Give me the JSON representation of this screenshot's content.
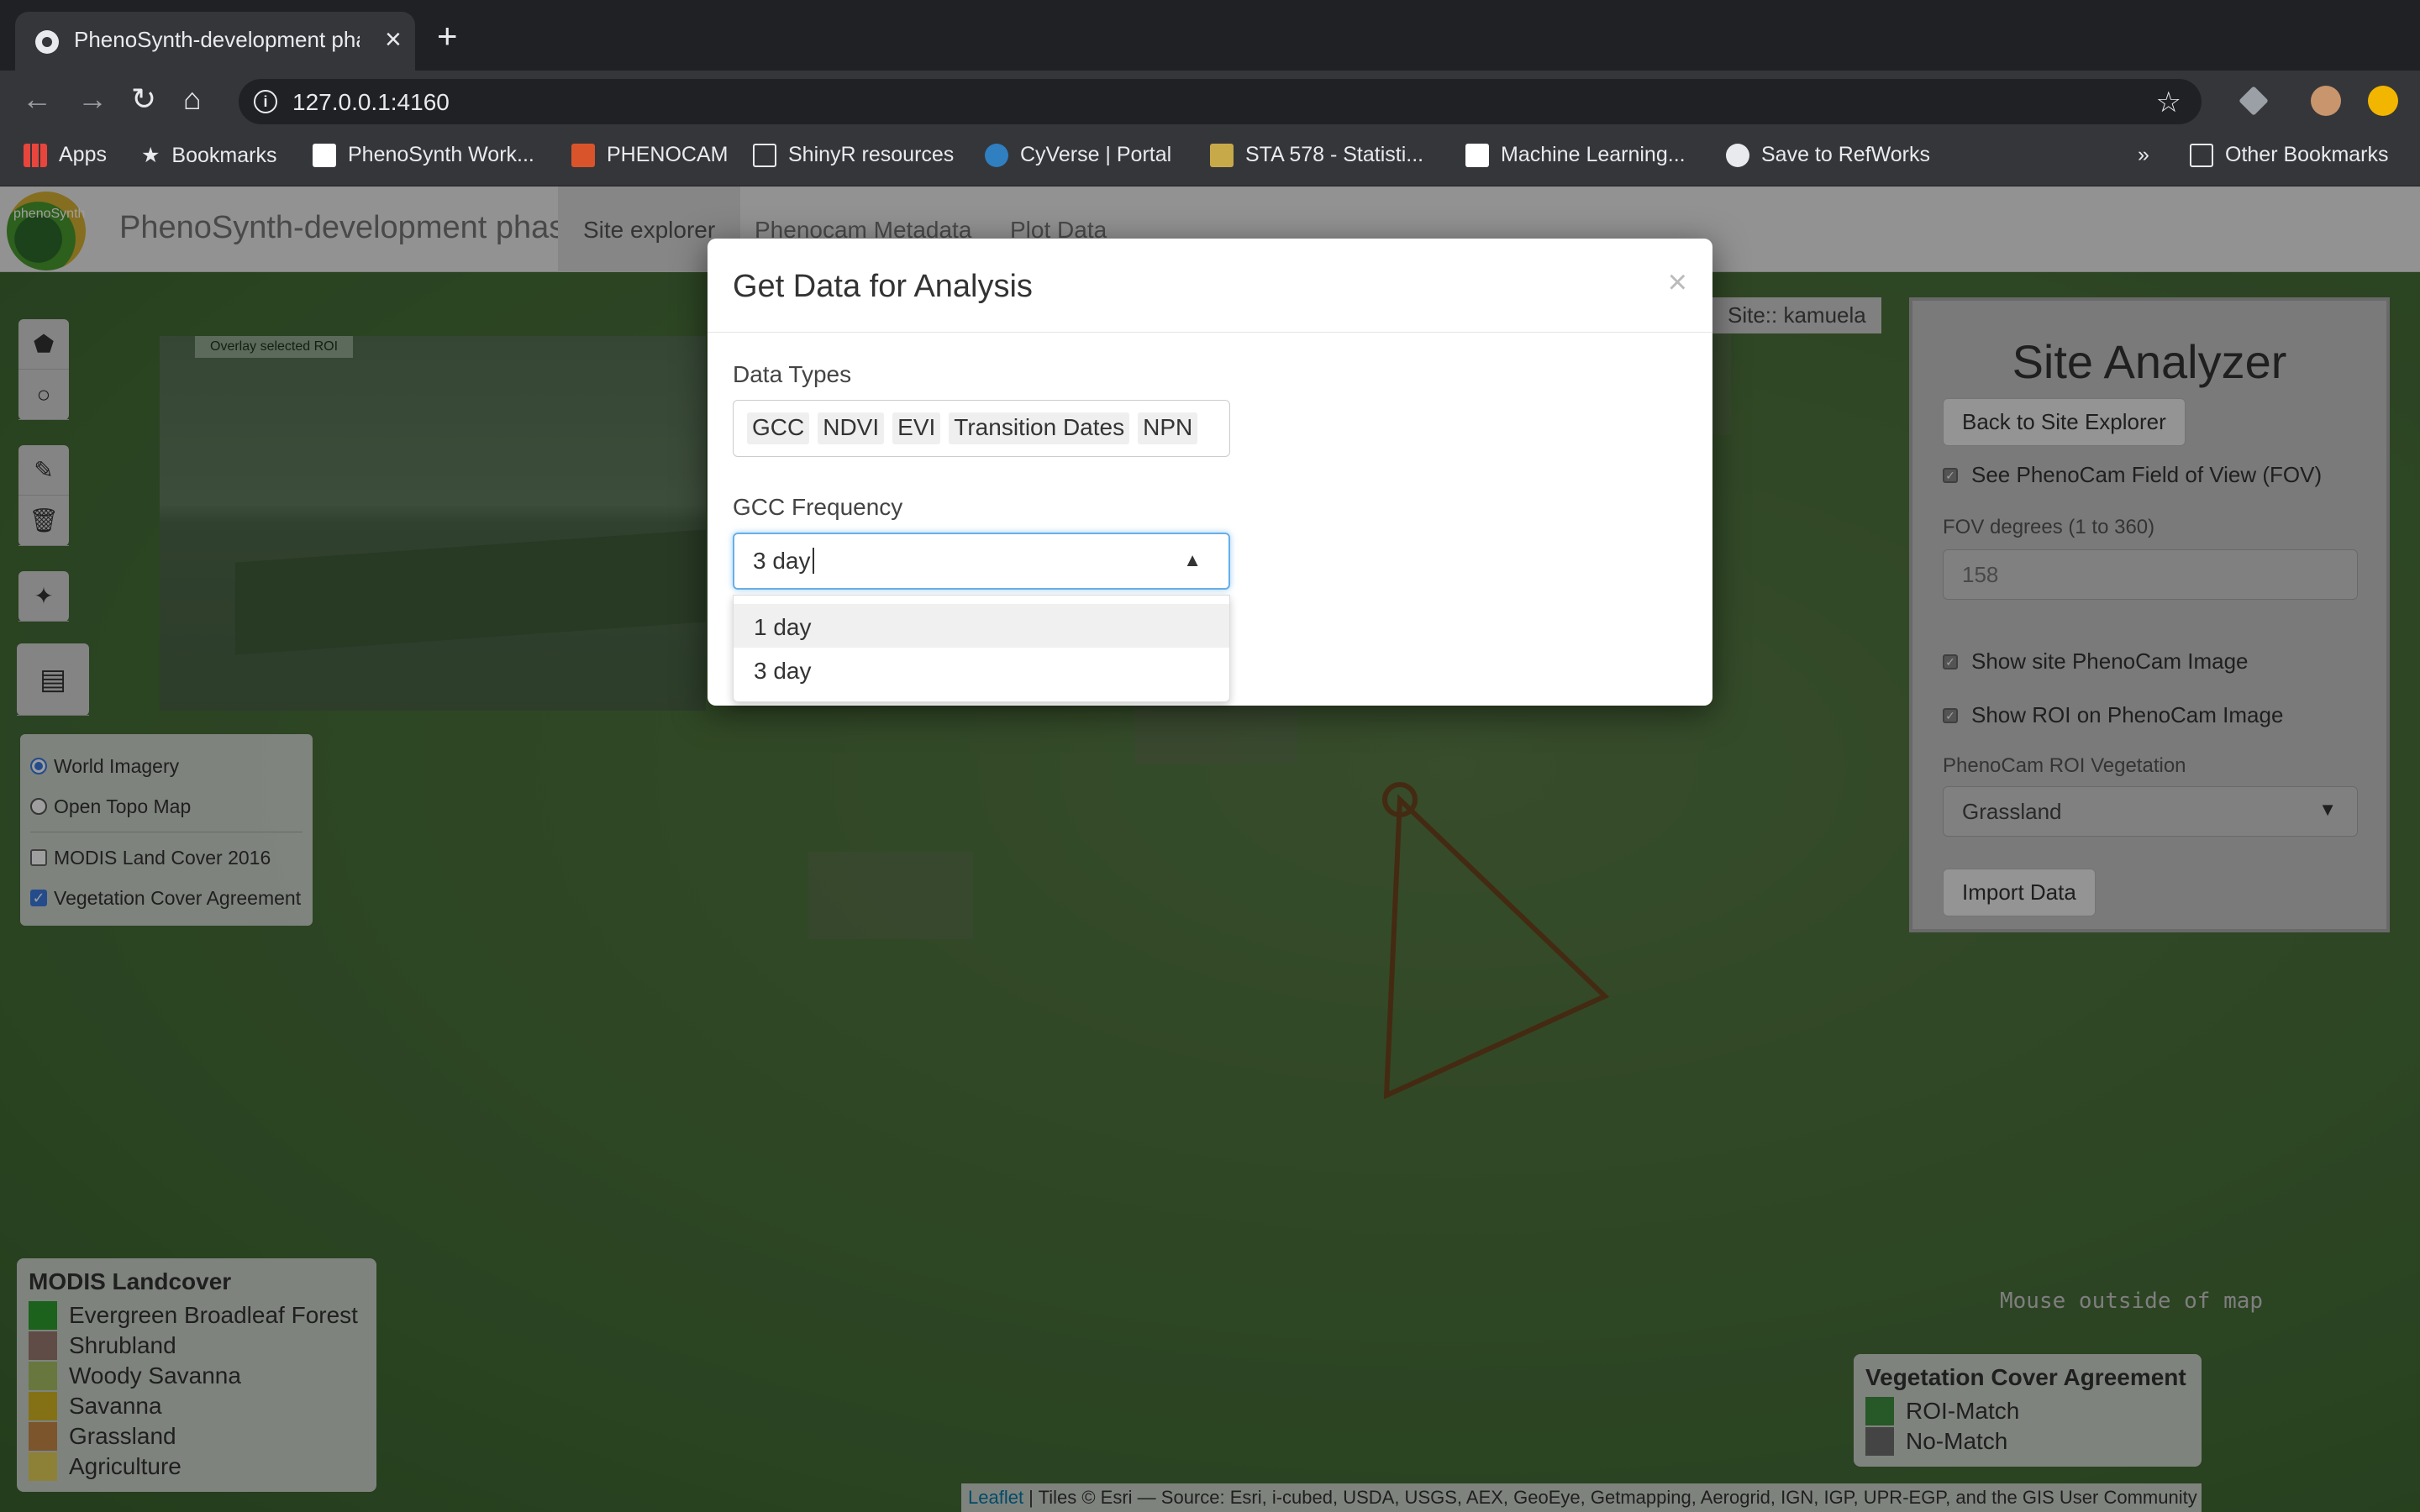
{
  "browser": {
    "tab_title": "PhenoSynth-development pha",
    "url": "127.0.0.1:4160",
    "bookmarks": [
      "Apps",
      "Bookmarks",
      "PhenoSynth Work...",
      "PHENOCAM",
      "ShinyR resources",
      "CyVerse | Portal",
      "STA 578 - Statisti...",
      "Machine Learning...",
      "Save to RefWorks"
    ],
    "more": "»",
    "other_bookmarks": "Other Bookmarks"
  },
  "app": {
    "logo_text": "phenoSynth",
    "brand": "PhenoSynth-development phase",
    "tabs": [
      "Site explorer",
      "Phenocam Metadata",
      "Plot Data"
    ]
  },
  "map": {
    "overlay_roi_label": "Overlay selected ROI",
    "site_badge": "Site:: kamuela",
    "layers": {
      "base": [
        "World Imagery",
        "Open Topo Map"
      ],
      "overlays": [
        "MODIS Land Cover 2016",
        "Vegetation Cover Agreement"
      ]
    },
    "modis_legend": {
      "title": "MODIS Landcover",
      "items": [
        {
          "label": "Evergreen Broadleaf Forest",
          "color": "#2e9e2e"
        },
        {
          "label": "Shrubland",
          "color": "#9b7b72"
        },
        {
          "label": "Woody Savanna",
          "color": "#a8c064"
        },
        {
          "label": "Savanna",
          "color": "#d6b624"
        },
        {
          "label": "Grassland",
          "color": "#c8894a"
        },
        {
          "label": "Agriculture",
          "color": "#e2d05a"
        }
      ]
    },
    "veg_legend": {
      "title": "Vegetation Cover Agreement",
      "items": [
        {
          "label": "ROI-Match",
          "color": "#3f8f3f"
        },
        {
          "label": "No-Match",
          "color": "#6e6e6e"
        }
      ]
    },
    "mouse_readout": "Mouse outside of map",
    "attribution_link": "Leaflet",
    "attribution_text": " | Tiles © Esri — Source: Esri, i-cubed, USDA, USGS, AEX, GeoEye, Getmapping, Aerogrid, IGN, IGP, UPR-EGP, and the GIS User Community"
  },
  "analyzer": {
    "title": "Site Analyzer",
    "back_button": "Back to Site Explorer",
    "fov_check": "See PhenoCam Field of View (FOV)",
    "fov_label": "FOV degrees (1 to 360)",
    "fov_value": "158",
    "show_image": "Show site PhenoCam Image",
    "show_roi": "Show ROI on PhenoCam Image",
    "roi_veg_label": "PhenoCam ROI Vegetation",
    "roi_veg_value": "Grassland",
    "import_button": "Import Data"
  },
  "modal": {
    "title": "Get Data for Analysis",
    "close": "×",
    "data_types_label": "Data Types",
    "data_types": [
      "GCC",
      "NDVI",
      "EVI",
      "Transition Dates",
      "NPN"
    ],
    "gcc_freq_label": "GCC Frequency",
    "gcc_freq_value": "3 day",
    "gcc_freq_options": [
      "1 day",
      "3 day"
    ]
  }
}
